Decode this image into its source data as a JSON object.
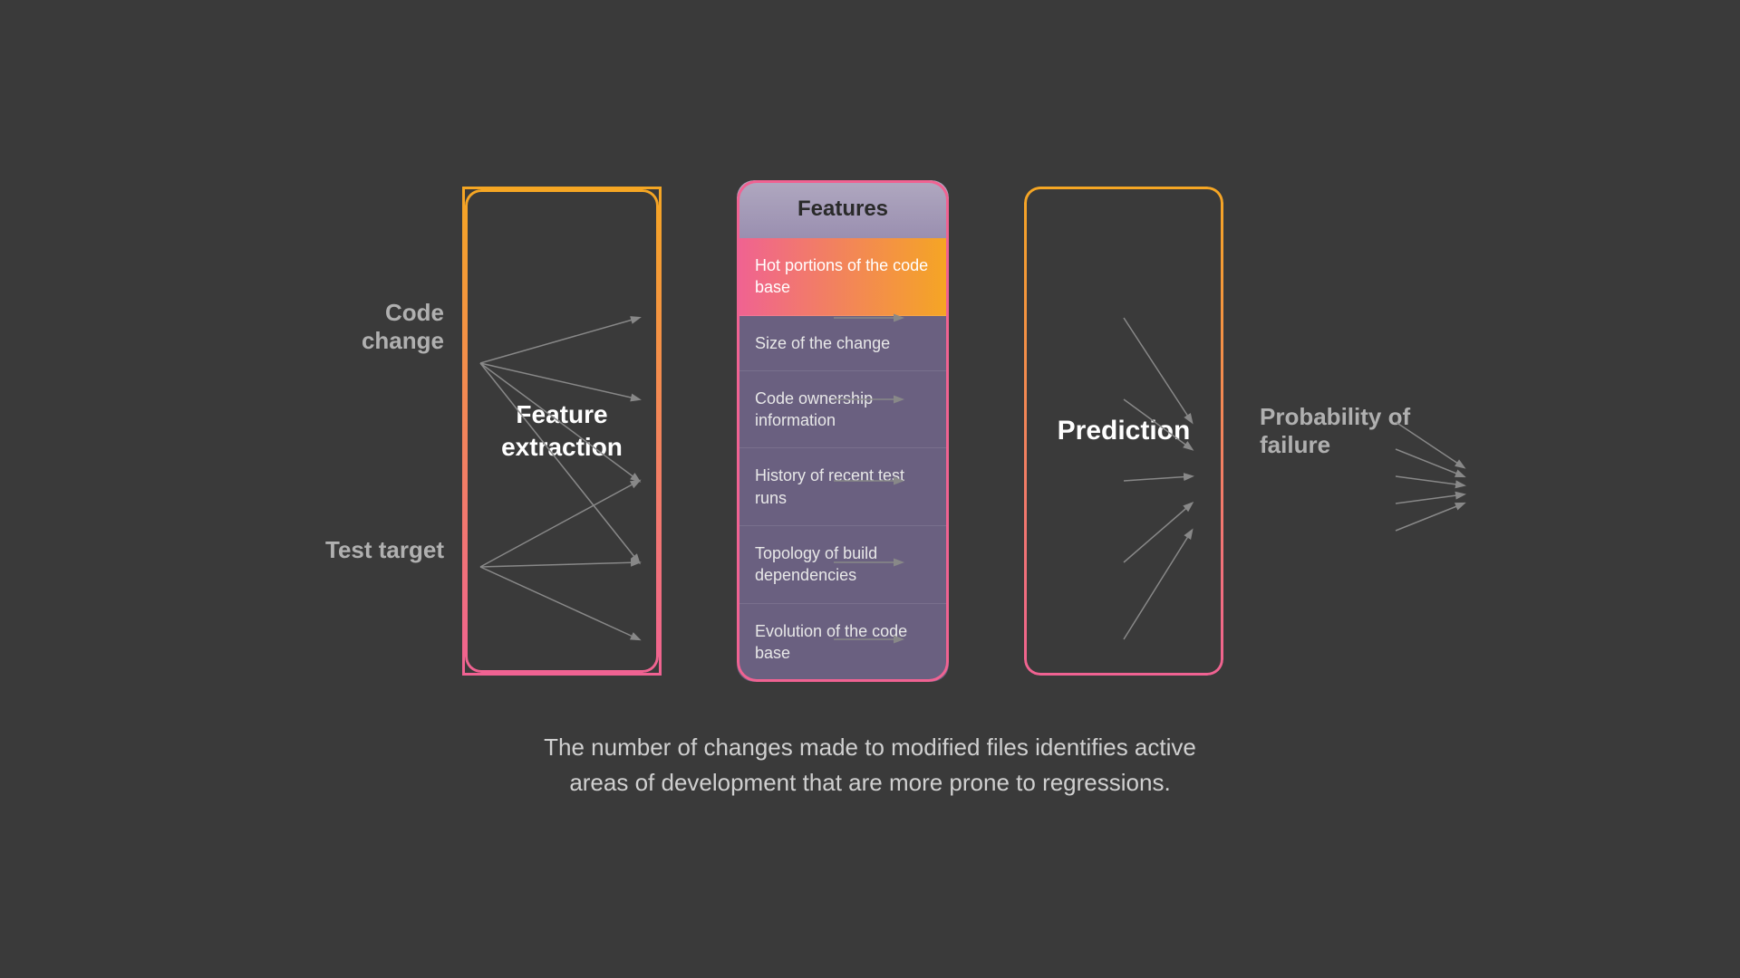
{
  "left": {
    "input1": "Code change",
    "input2": "Test target"
  },
  "feature_extraction": {
    "title": "Feature\nextraction"
  },
  "features_panel": {
    "header": "Features",
    "items": [
      {
        "label": "Hot portions of the code base",
        "highlighted": true
      },
      {
        "label": "Size of the change",
        "highlighted": false
      },
      {
        "label": "Code ownership information",
        "highlighted": false
      },
      {
        "label": "History of recent test runs",
        "highlighted": false
      },
      {
        "label": "Topology of build dependencies",
        "highlighted": false
      },
      {
        "label": "Evolution of the code base",
        "highlighted": false
      }
    ]
  },
  "prediction": {
    "title": "Prediction"
  },
  "right": {
    "output": "Probability of failure"
  },
  "caption": "The number of changes made to modified files identifies active areas of development that are more prone to regressions."
}
